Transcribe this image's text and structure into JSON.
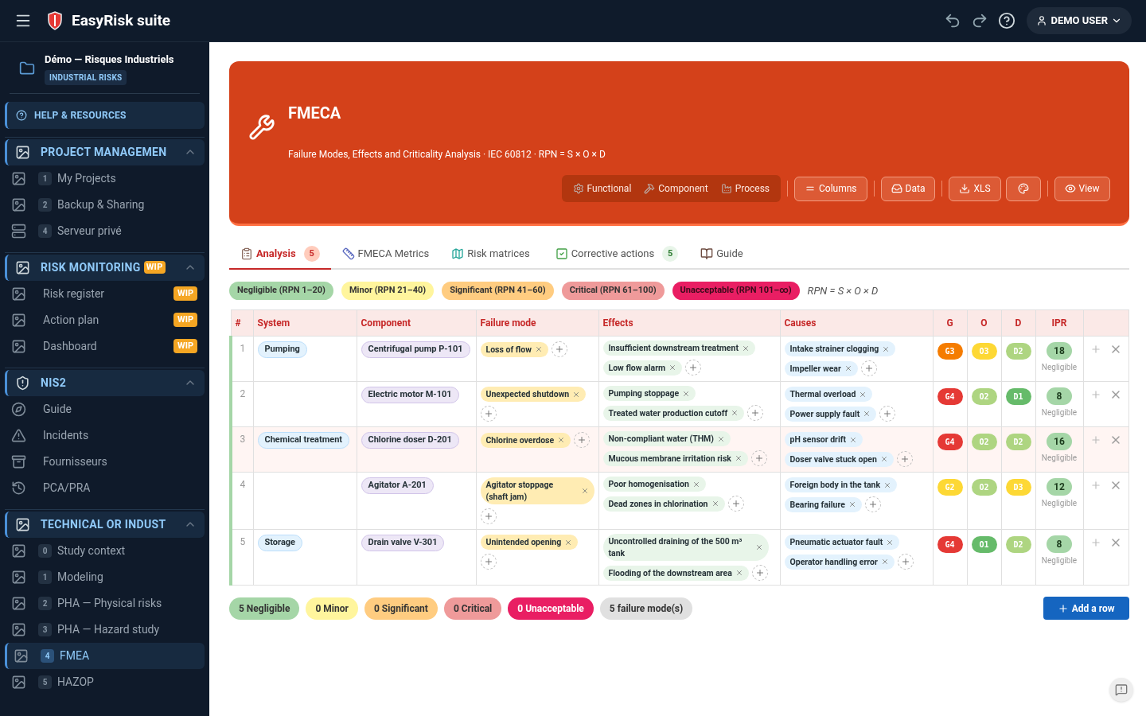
{
  "app": {
    "title": "EasyRisk suite",
    "user": "DEMO USER"
  },
  "project": {
    "name": "Démo — Risques Industriels",
    "tag": "INDUSTRIAL RISKS"
  },
  "help": "HELP & RESOURCES",
  "sections": [
    {
      "title": "PROJECT MANAGEMEN",
      "expanded": true,
      "items": [
        {
          "number": "1",
          "label": "My Projects",
          "selected": false
        },
        {
          "number": "2",
          "label": "Backup & Sharing",
          "selected": false
        },
        {
          "number": "4",
          "label": "Serveur privé",
          "selected": false
        }
      ]
    },
    {
      "title": "RISK MONITORING",
      "badge": "WIP",
      "expanded": true,
      "items": [
        {
          "label": "Risk register",
          "badge": "WIP",
          "selected": false
        },
        {
          "label": "Action plan",
          "badge": "WIP",
          "selected": false
        },
        {
          "label": "Dashboard",
          "badge": "WIP",
          "selected": false
        }
      ]
    },
    {
      "title": "NIS2",
      "expanded": true,
      "items": [
        {
          "label": "Guide",
          "selected": false
        },
        {
          "label": "Incidents",
          "selected": false
        },
        {
          "label": "Fournisseurs",
          "selected": false
        },
        {
          "label": "PCA/PRA",
          "selected": false
        }
      ]
    },
    {
      "title": "TECHNICAL OR INDUST",
      "expanded": true,
      "items": [
        {
          "number": "0",
          "label": "Study context",
          "selected": false
        },
        {
          "number": "1",
          "label": "Modeling",
          "selected": false
        },
        {
          "number": "2",
          "label": "PHA — Physical risks",
          "selected": false
        },
        {
          "number": "3",
          "label": "PHA — Hazard study",
          "selected": false
        },
        {
          "number": "4",
          "label": "FMEA",
          "selected": true
        },
        {
          "number": "5",
          "label": "HAZOP",
          "selected": false
        }
      ]
    }
  ],
  "header": {
    "title": "FMECA",
    "subtitle": "Failure Modes, Effects and Criticality Analysis · IEC 60812 · RPN = S × O × D",
    "views": [
      {
        "label": "Functional",
        "selected": false
      },
      {
        "label": "Component",
        "selected": false
      },
      {
        "label": "Process",
        "selected": false
      }
    ],
    "buttons": [
      "Columns",
      "Data",
      "XLS",
      "View"
    ]
  },
  "tabs": [
    {
      "label": "Analysis",
      "count": "5",
      "selected": true
    },
    {
      "label": "FMECA Metrics",
      "selected": false
    },
    {
      "label": "Risk matrices",
      "selected": false
    },
    {
      "label": "Corrective actions",
      "count": "5",
      "selected": false
    },
    {
      "label": "Guide",
      "selected": false
    }
  ],
  "legend": [
    {
      "label": "Negligible (RPN 1–20)",
      "color": "#a5d6a7"
    },
    {
      "label": "Minor (RPN 21–40)",
      "color": "#fff59d"
    },
    {
      "label": "Significant (RPN 41–60)",
      "color": "#ffcc80"
    },
    {
      "label": "Critical (RPN 61–100)",
      "color": "#ef9a9a"
    },
    {
      "label": "Unacceptable (RPN 101–∞)",
      "color": "#e91e63"
    }
  ],
  "formula": "RPN = S × O × D",
  "table": {
    "columns": [
      "#",
      "System",
      "Component",
      "Failure mode",
      "Effects",
      "Causes",
      "G",
      "O",
      "D",
      "IPR"
    ],
    "rows": [
      {
        "number": "1",
        "system": "Pumping",
        "component": "Centrifugal pump P-101",
        "failure_modes": [
          "Loss of flow"
        ],
        "effects": [
          "Insufficient downstream treatment",
          "Low flow alarm"
        ],
        "causes": [
          "Intake strainer clogging",
          "Impeller wear"
        ],
        "g": {
          "label": "G3",
          "color": "#f57c00"
        },
        "o": {
          "label": "O3",
          "color": "#fdd835"
        },
        "d": {
          "label": "D2",
          "color": "#aed581"
        },
        "ipr": "18",
        "ipr_level": "Negligible",
        "highlighted": false
      },
      {
        "number": "2",
        "component": "Electric motor M-101",
        "failure_modes": [
          "Unexpected shutdown"
        ],
        "effects": [
          "Pumping stoppage",
          "Treated water production cutoff"
        ],
        "causes": [
          "Thermal overload",
          "Power supply fault"
        ],
        "g": {
          "label": "G4",
          "color": "#e53935"
        },
        "o": {
          "label": "O2",
          "color": "#aed581"
        },
        "d": {
          "label": "D1",
          "color": "#66bb6a"
        },
        "ipr": "8",
        "ipr_level": "Negligible",
        "highlighted": false
      },
      {
        "number": "3",
        "system": "Chemical treatment",
        "component": "Chlorine doser D-201",
        "failure_modes": [
          "Chlorine overdose"
        ],
        "effects": [
          "Non-compliant water (THM)",
          "Mucous membrane irritation risk"
        ],
        "causes": [
          "pH sensor drift",
          "Doser valve stuck open"
        ],
        "g": {
          "label": "G4",
          "color": "#e53935"
        },
        "o": {
          "label": "O2",
          "color": "#aed581"
        },
        "d": {
          "label": "D2",
          "color": "#aed581"
        },
        "ipr": "16",
        "ipr_level": "Negligible",
        "highlighted": true
      },
      {
        "number": "4",
        "component": "Agitator A-201",
        "failure_modes": [
          "Agitator stoppage (shaft jam)"
        ],
        "effects": [
          "Poor homogenisation",
          "Dead zones in chlorination"
        ],
        "causes": [
          "Foreign body in the tank",
          "Bearing failure"
        ],
        "g": {
          "label": "G2",
          "color": "#fdd835"
        },
        "o": {
          "label": "O2",
          "color": "#aed581"
        },
        "d": {
          "label": "D3",
          "color": "#fdd835"
        },
        "ipr": "12",
        "ipr_level": "Negligible",
        "highlighted": false
      },
      {
        "number": "5",
        "system": "Storage",
        "component": "Drain valve V-301",
        "failure_modes": [
          "Unintended opening"
        ],
        "effects": [
          "Uncontrolled draining of the 500 m³ tank",
          "Flooding of the downstream area"
        ],
        "causes": [
          "Pneumatic actuator fault",
          "Operator handling error"
        ],
        "g": {
          "label": "G4",
          "color": "#e53935"
        },
        "o": {
          "label": "O1",
          "color": "#66bb6a"
        },
        "d": {
          "label": "D2",
          "color": "#aed581"
        },
        "ipr": "8",
        "ipr_level": "Negligible",
        "highlighted": false
      }
    ]
  },
  "summary": [
    {
      "label": "5 Negligible",
      "color": "#a5d6a7"
    },
    {
      "label": "0 Minor",
      "color": "#fff59d"
    },
    {
      "label": "0 Significant",
      "color": "#ffcc80"
    },
    {
      "label": "0 Critical",
      "color": "#ef9a9a"
    },
    {
      "label": "0 Unacceptable",
      "color": "#e91e63"
    },
    {
      "label": "5 failure mode(s)",
      "color": "#e0e0e0"
    }
  ],
  "add_button": "Add a row"
}
